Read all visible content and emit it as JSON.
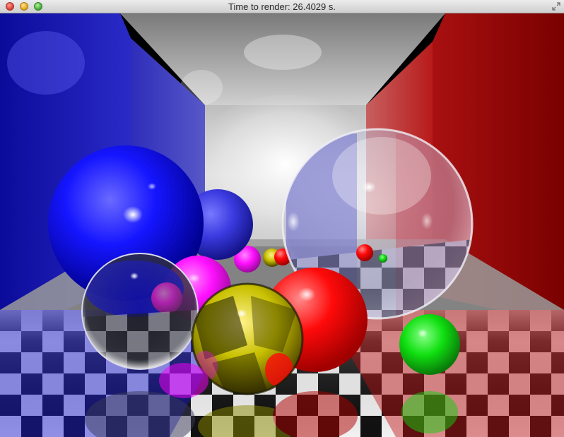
{
  "window": {
    "title": "Time to render: 26.4029 s."
  },
  "icons": {
    "close": "close-button-icon",
    "minimize": "minimize-button-icon",
    "zoom": "zoom-button-icon",
    "fullscreen": "fullscreen-arrows-icon"
  },
  "scene": {
    "colors": {
      "left_wall": "#0a0aa0",
      "right_wall": "#8a0000",
      "back_wall": "#d8d8d8",
      "floor_light": "#ffffff",
      "floor_dark": "#1a1a1a",
      "blue_sphere": "#0000ff",
      "magenta_sphere": "#ff00ff",
      "yellow_sphere": "#d8d800",
      "red_sphere": "#ff0000",
      "green_sphere": "#00e000",
      "glass_sphere": "#c8c8d8"
    }
  }
}
